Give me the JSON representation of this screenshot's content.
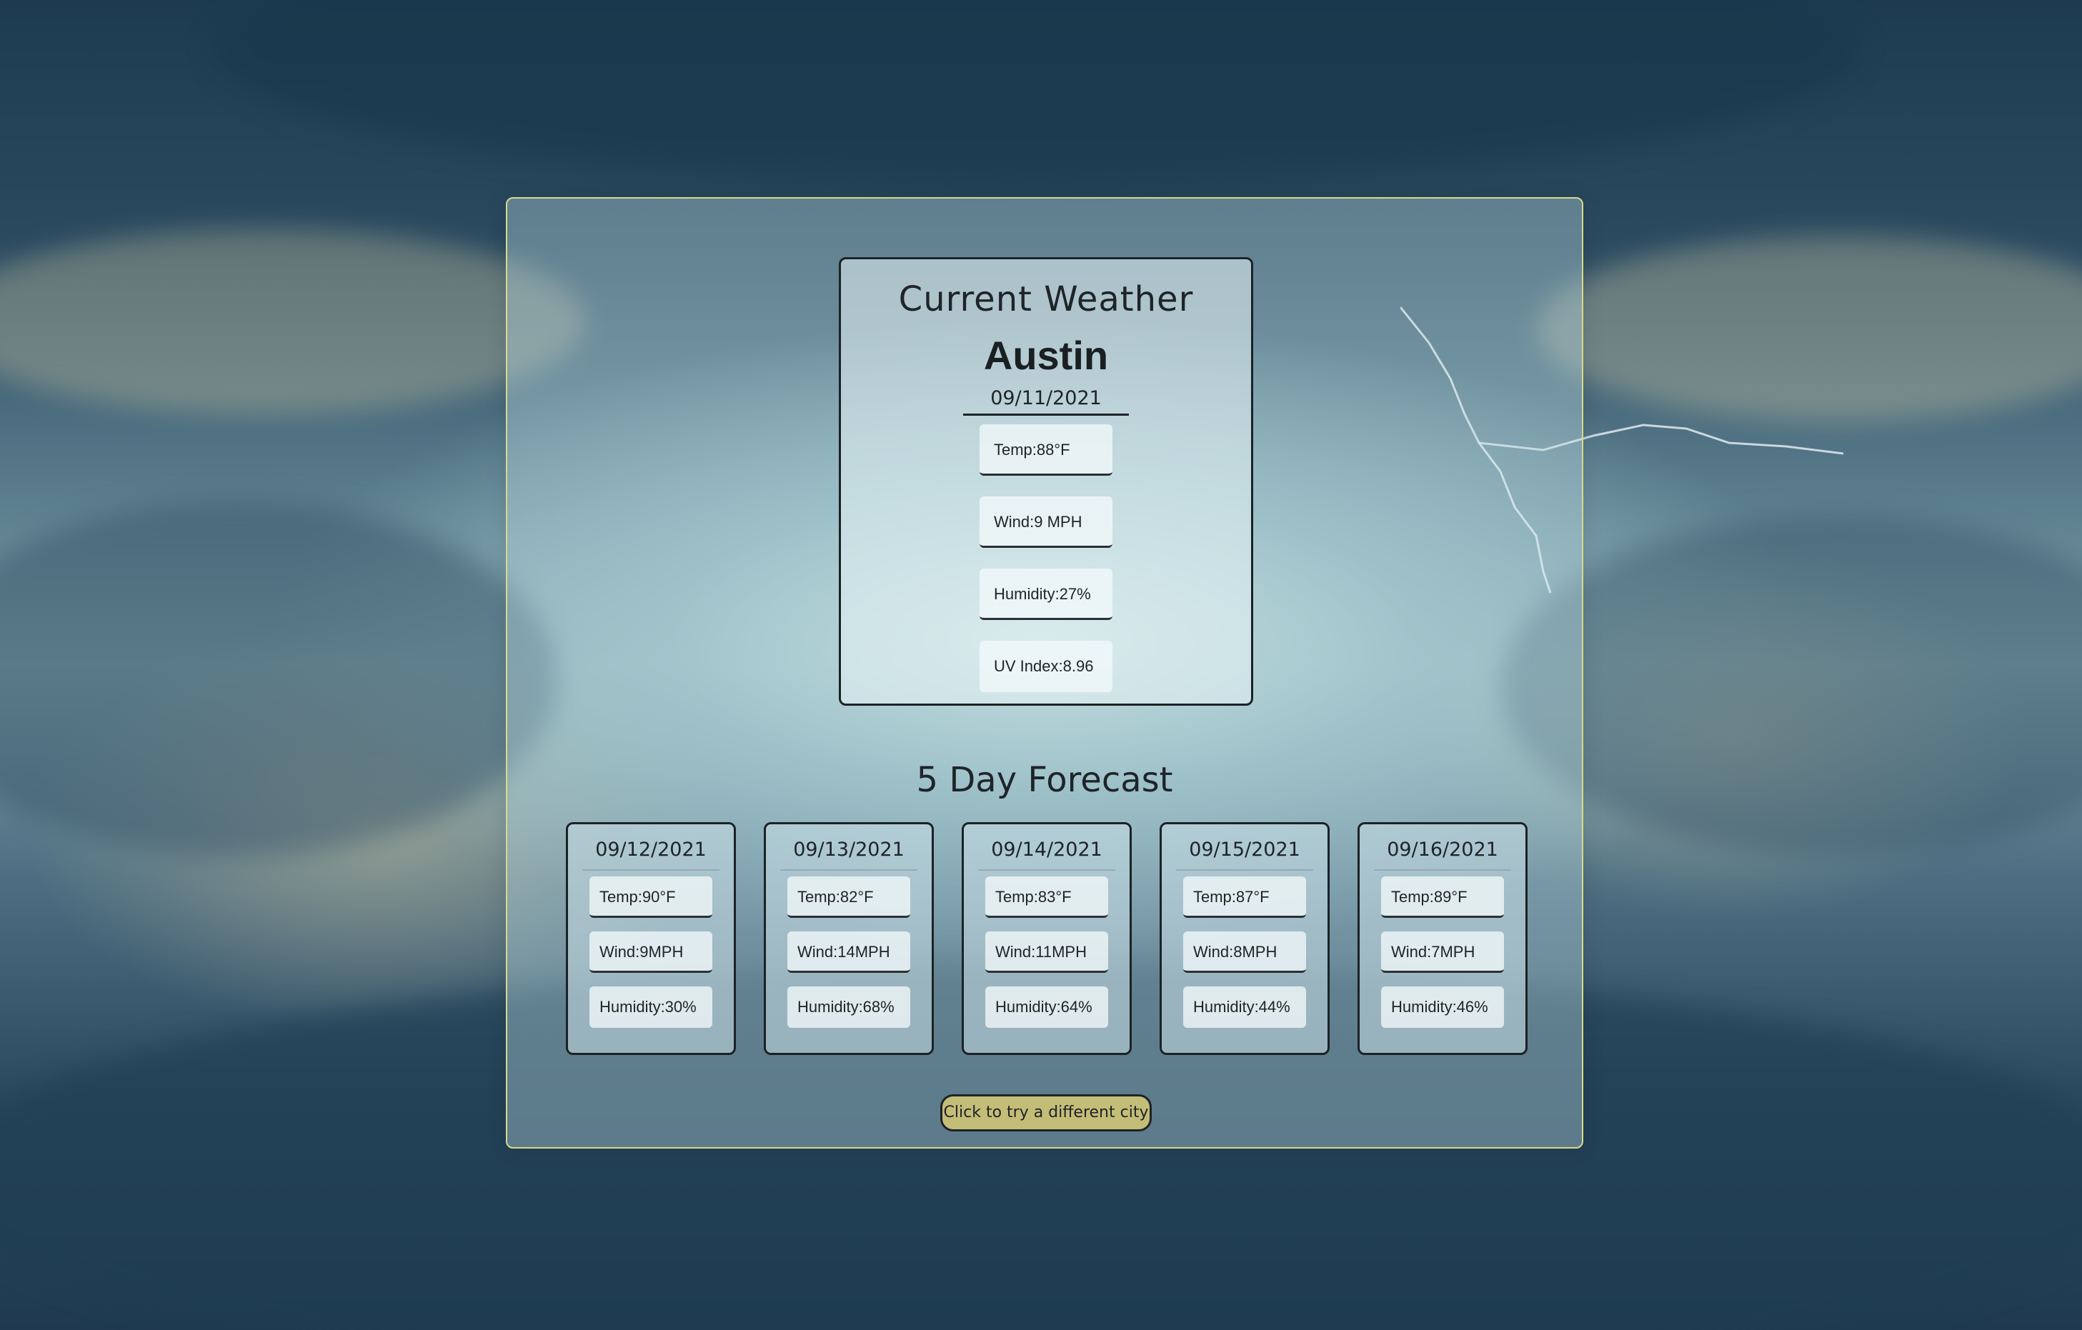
{
  "current": {
    "heading": "Current Weather",
    "city": "Austin",
    "date": "09/11/2021",
    "temp": "Temp:88°F",
    "wind": "Wind:9 MPH",
    "humidity": "Humidity:27%",
    "uv_index": "UV Index:8.96"
  },
  "forecast": {
    "heading": "5 Day Forecast",
    "days": [
      {
        "date": "09/12/2021",
        "temp": "Temp:90°F",
        "wind": "Wind:9MPH",
        "humidity": "Humidity:30%"
      },
      {
        "date": "09/13/2021",
        "temp": "Temp:82°F",
        "wind": "Wind:14MPH",
        "humidity": "Humidity:68%"
      },
      {
        "date": "09/14/2021",
        "temp": "Temp:83°F",
        "wind": "Wind:11MPH",
        "humidity": "Humidity:64%"
      },
      {
        "date": "09/15/2021",
        "temp": "Temp:87°F",
        "wind": "Wind:8MPH",
        "humidity": "Humidity:44%"
      },
      {
        "date": "09/16/2021",
        "temp": "Temp:89°F",
        "wind": "Wind:7MPH",
        "humidity": "Humidity:46%"
      }
    ]
  },
  "actions": {
    "try_different_city": "Click to try a different city"
  },
  "colors": {
    "panel_border": "#d9d98a",
    "button_bg": "#c4bd78",
    "card_border": "#1c2226"
  }
}
